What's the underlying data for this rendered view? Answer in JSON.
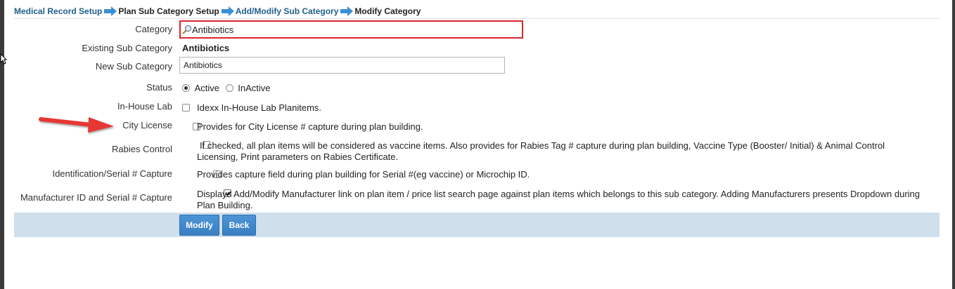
{
  "breadcrumb": {
    "items": [
      "Medical Record Setup",
      "Plan Sub Category Setup",
      "Add/Modify Sub Category",
      "Modify Category"
    ]
  },
  "form": {
    "category": {
      "label": "Category",
      "value": "Antibiotics"
    },
    "existing_sub_category": {
      "label": "Existing Sub Category",
      "value": "Antibiotics"
    },
    "new_sub_category": {
      "label": "New Sub Category",
      "value": "Antibiotics"
    },
    "status": {
      "label": "Status",
      "options": [
        "Active",
        "InActive"
      ],
      "selected": "Active"
    },
    "in_house_lab": {
      "label": "In-House Lab",
      "text": "Idexx In-House Lab Planitems.",
      "checked": false
    },
    "city_license": {
      "label": "City License",
      "text": "Provides for City License # capture during plan building.",
      "checked": false
    },
    "rabies_control": {
      "label": "Rabies Control",
      "text": "If checked, all plan items will be considered as vaccine items. Also provides for Rabies Tag # capture during plan building, Vaccine Type (Booster/ Initial) & Animal Control Licensing, Print parameters on Rabies Certificate.",
      "checked": false
    },
    "identification_serial": {
      "label": "Identification/Serial # Capture",
      "text": "Provides capture field during plan building for Serial #(eg vaccine) or Microchip ID.",
      "checked": false
    },
    "manufacturer_serial": {
      "label": "Manufacturer ID and Serial # Capture",
      "text": "Displays Add/Modify Manufacturer link on plan item / price list search page against plan items which belongs to this sub category. Adding Manufacturers presents Dropdown during Plan Building.",
      "checked": true
    }
  },
  "actions": {
    "modify": "Modify",
    "back": "Back"
  },
  "colors": {
    "link": "#1f5f8b",
    "highlight_border": "#d9262d",
    "button": "#3a7fc2",
    "action_bar": "#cfdfec",
    "annotation_arrow": "#e53935"
  },
  "icons": {
    "breadcrumb_separator": "arrow-right-icon",
    "category_search": "magnifier-icon",
    "annotation": "red-arrow-icon"
  }
}
